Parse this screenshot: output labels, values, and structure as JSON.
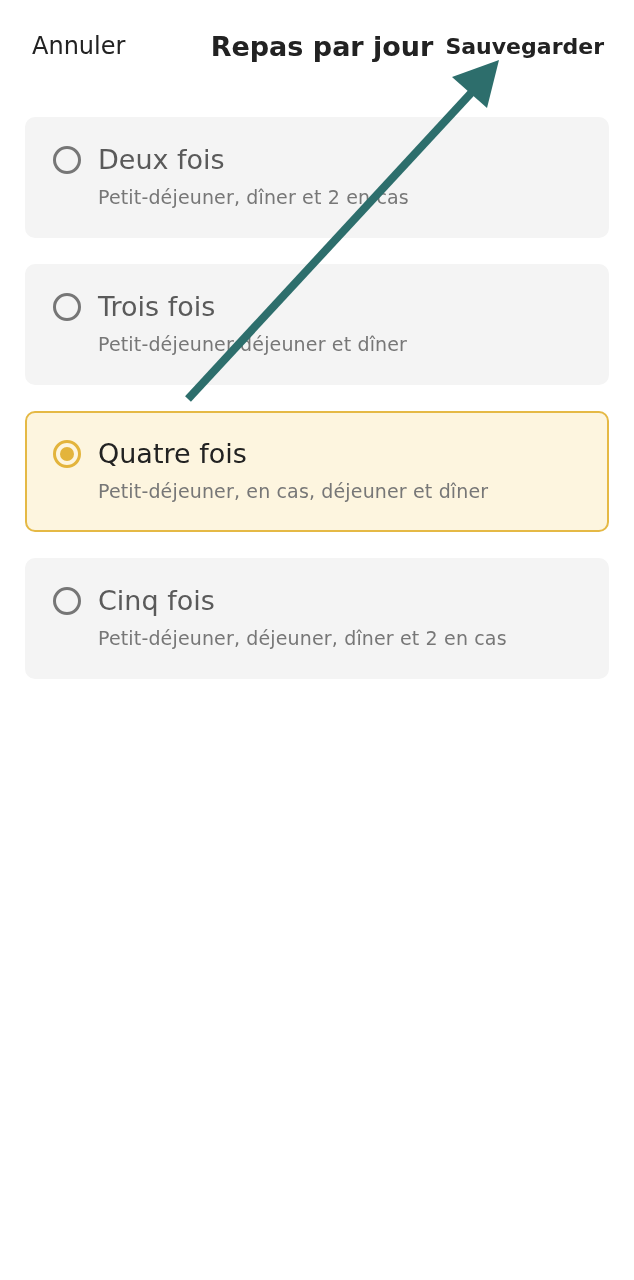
{
  "header": {
    "cancel": "Annuler",
    "title": "Repas par jour",
    "save": "Sauvegarder"
  },
  "options": [
    {
      "title": "Deux fois",
      "description": "Petit-déjeuner, dîner et 2 en cas",
      "selected": false
    },
    {
      "title": "Trois fois",
      "description": "Petit-déjeuner déjeuner et dîner",
      "selected": false
    },
    {
      "title": "Quatre fois",
      "description": "Petit-déjeuner, en cas, déjeuner et dîner",
      "selected": true
    },
    {
      "title": "Cinq fois",
      "description": "Petit-déjeuner, déjeuner, dîner et 2 en cas",
      "selected": false
    }
  ]
}
